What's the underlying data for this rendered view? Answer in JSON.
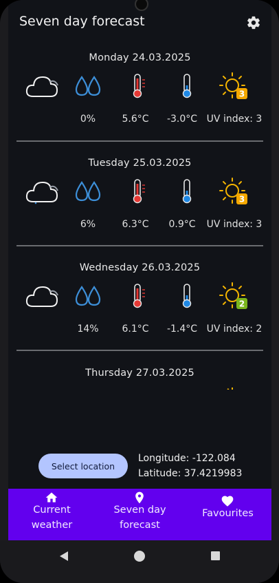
{
  "header": {
    "title": "Seven day forecast",
    "settings_icon": "gear-icon"
  },
  "days": [
    {
      "date": "Monday  24.03.2025",
      "precipitation": "0%",
      "max_temp": "5.6°C",
      "min_temp": "-3.0°C",
      "uv_label": "UV index: 3",
      "uv_value": "3",
      "uv_color": "#f5a800"
    },
    {
      "date": "Tuesday  25.03.2025",
      "precipitation": "6%",
      "max_temp": "6.3°C",
      "min_temp": "0.9°C",
      "uv_label": "UV index: 3",
      "uv_value": "3",
      "uv_color": "#f5a800"
    },
    {
      "date": "Wednesday  26.03.2025",
      "precipitation": "14%",
      "max_temp": "6.1°C",
      "min_temp": "-1.4°C",
      "uv_label": "UV index: 2",
      "uv_value": "2",
      "uv_color": "#7ab51d"
    },
    {
      "date": "Thursday  27.03.2025"
    }
  ],
  "location": {
    "button_label": "Select location",
    "longitude": "Longitude: -122.084",
    "latitude": "Latitude: 37.4219983"
  },
  "bottom_nav": {
    "items": [
      {
        "line1": "Current",
        "line2": "weather",
        "icon": "home-icon"
      },
      {
        "line1": "Seven day",
        "line2": "forecast",
        "icon": "location-pin-icon"
      },
      {
        "line1": "Favourites",
        "line2": "",
        "icon": "heart-icon"
      }
    ]
  },
  "colors": {
    "nav_bg": "#6200ee",
    "button_bg": "#b3c5ff",
    "screen_bg": "#111318"
  }
}
